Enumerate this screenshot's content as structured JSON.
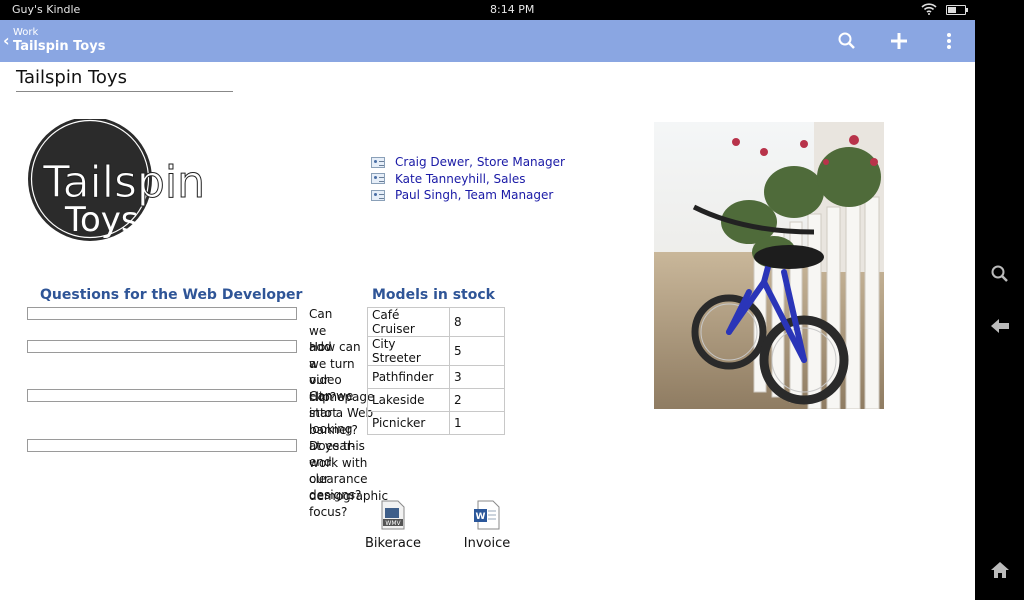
{
  "status": {
    "device": "Guy's Kindle",
    "time": "8:14 PM"
  },
  "appbar": {
    "crumb": "Work",
    "title": "Tailspin Toys",
    "icons": [
      "back-chevron-icon",
      "search-icon",
      "plus-icon",
      "overflow-menu-icon"
    ]
  },
  "page": {
    "title": "Tailspin Toys"
  },
  "logo": {
    "line1": "Tailspin",
    "line2": "Toys"
  },
  "contacts": [
    {
      "label": "Craig Dewer, Store Manager"
    },
    {
      "label": "Kate Tanneyhill, Sales"
    },
    {
      "label": "Paul Singh, Team Manager"
    }
  ],
  "questions": {
    "heading": "Questions for the Web Developer",
    "items": [
      "Can we add a video clip?",
      "How can we turn our Homepage into a Web banner?",
      "Can we start looking at year-end clearance designs?",
      "Does this work with our demographic focus?"
    ]
  },
  "models": {
    "heading": "Models in stock",
    "rows": [
      {
        "name": "Café Cruiser",
        "qty": "8"
      },
      {
        "name": "City Streeter",
        "qty": "5"
      },
      {
        "name": "Pathfinder",
        "qty": "3"
      },
      {
        "name": "Lakeside",
        "qty": "2"
      },
      {
        "name": "Picnicker",
        "qty": "1"
      }
    ]
  },
  "attachments": [
    {
      "label": "Bikerace",
      "badge": "WMV"
    },
    {
      "label": "Invoice",
      "badge": "W"
    }
  ],
  "colors": {
    "appbar": "#8aa6e2",
    "heading": "#2f5597",
    "link": "#1a1aa6"
  }
}
